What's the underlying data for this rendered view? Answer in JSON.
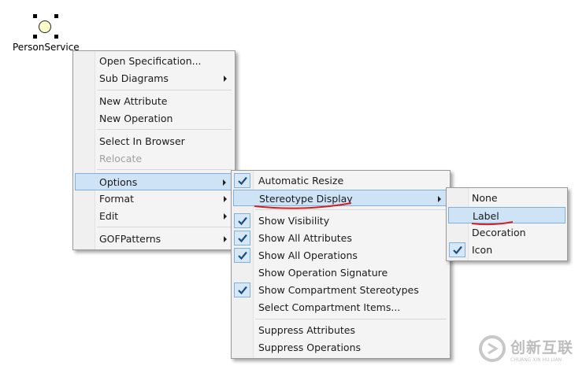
{
  "element": {
    "label": "PersonService"
  },
  "context_menu": {
    "items": [
      {
        "label": "Open Specification..."
      },
      {
        "label": "Sub Diagrams"
      },
      {
        "label": "New Attribute"
      },
      {
        "label": "New Operation"
      },
      {
        "label": "Select In Browser"
      },
      {
        "label": "Relocate"
      },
      {
        "label": "Options"
      },
      {
        "label": "Format"
      },
      {
        "label": "Edit"
      },
      {
        "label": "GOFPatterns"
      }
    ]
  },
  "options_menu": {
    "items": [
      {
        "label": "Automatic Resize",
        "checked": true
      },
      {
        "label": "Stereotype Display",
        "checked": false
      },
      {
        "label": "Show Visibility",
        "checked": true
      },
      {
        "label": "Show All Attributes",
        "checked": true
      },
      {
        "label": "Show All Operations",
        "checked": true
      },
      {
        "label": "Show Operation Signature",
        "checked": false
      },
      {
        "label": "Show Compartment Stereotypes",
        "checked": true
      },
      {
        "label": "Select Compartment Items...",
        "checked": false
      },
      {
        "label": "Suppress Attributes",
        "checked": false
      },
      {
        "label": "Suppress Operations",
        "checked": false
      }
    ]
  },
  "stereotype_menu": {
    "items": [
      {
        "label": "None",
        "checked": false
      },
      {
        "label": "Label",
        "checked": false
      },
      {
        "label": "Decoration",
        "checked": false
      },
      {
        "label": "Icon",
        "checked": true
      }
    ]
  },
  "watermark": {
    "text": "创新互联",
    "subtext": "CHUANG XIN HU LIAN"
  },
  "colors": {
    "highlight": "#cfe3f7",
    "annotation": "#d42020",
    "check": "#1a4d80"
  }
}
